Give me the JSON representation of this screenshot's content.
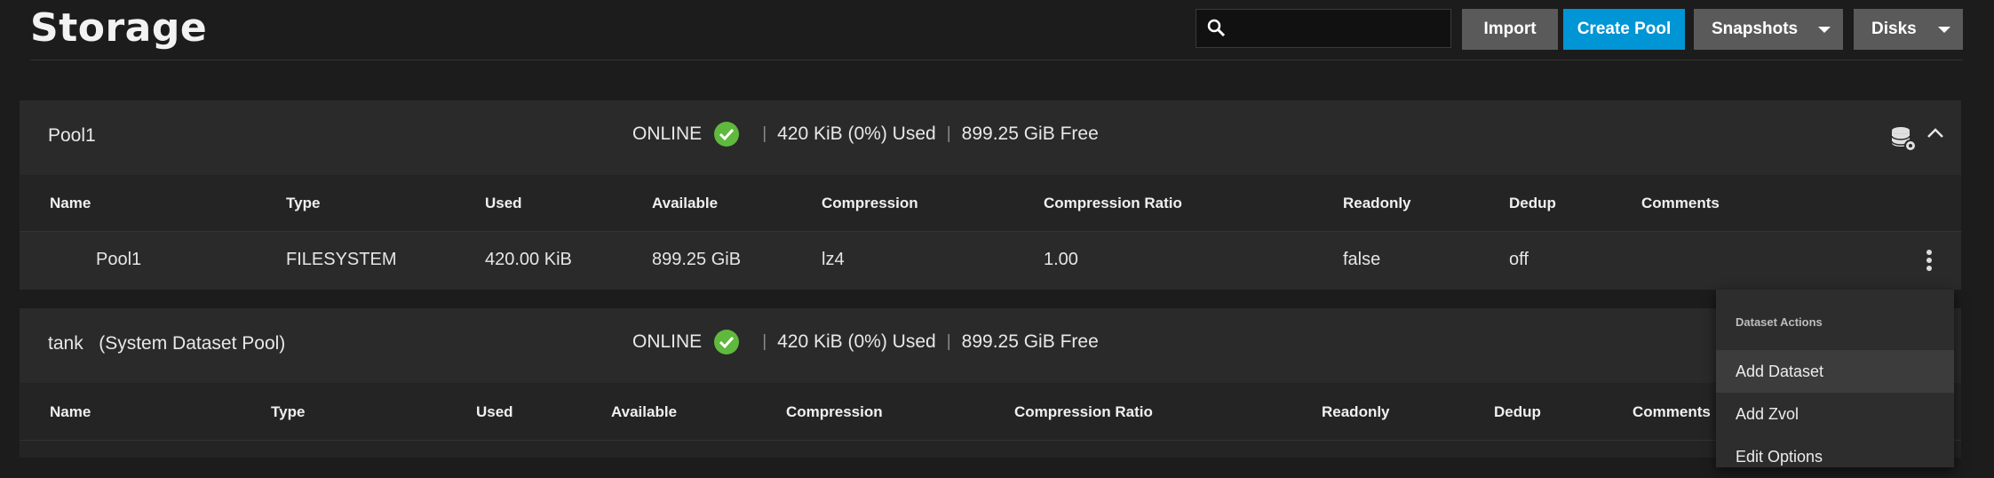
{
  "header": {
    "title": "Storage",
    "search": {
      "value": "",
      "placeholder": ""
    },
    "buttons": {
      "import": "Import",
      "create_pool": "Create Pool",
      "snapshots": "Snapshots",
      "disks": "Disks"
    }
  },
  "columns": [
    "Name",
    "Type",
    "Used",
    "Available",
    "Compression",
    "Compression Ratio",
    "Readonly",
    "Dedup",
    "Comments"
  ],
  "pools": [
    {
      "name": "Pool1",
      "status": "ONLINE",
      "used": "420 KiB (0%) Used",
      "free": "899.25 GiB Free",
      "datasets": [
        {
          "name": "Pool1",
          "type": "FILESYSTEM",
          "used": "420.00 KiB",
          "available": "899.25 GiB",
          "compression": "lz4",
          "ratio": "1.00",
          "readonly": "false",
          "dedup": "off",
          "comments": ""
        }
      ]
    },
    {
      "name": "tank",
      "suffix": "(System Dataset Pool)",
      "status": "ONLINE",
      "used": "420 KiB (0%) Used",
      "free": "899.25 GiB Free"
    }
  ],
  "dataset_menu": {
    "title": "Dataset Actions",
    "items": [
      "Add Dataset",
      "Add Zvol",
      "Edit Options"
    ]
  },
  "colors": {
    "accent": "#0095d5",
    "online": "#5fb93c",
    "background": "#1c1c1c"
  },
  "icons": [
    "search-icon",
    "check-circle-icon",
    "pool-settings-icon",
    "chevron-up-icon",
    "more-vert-icon",
    "caret-down-icon"
  ]
}
